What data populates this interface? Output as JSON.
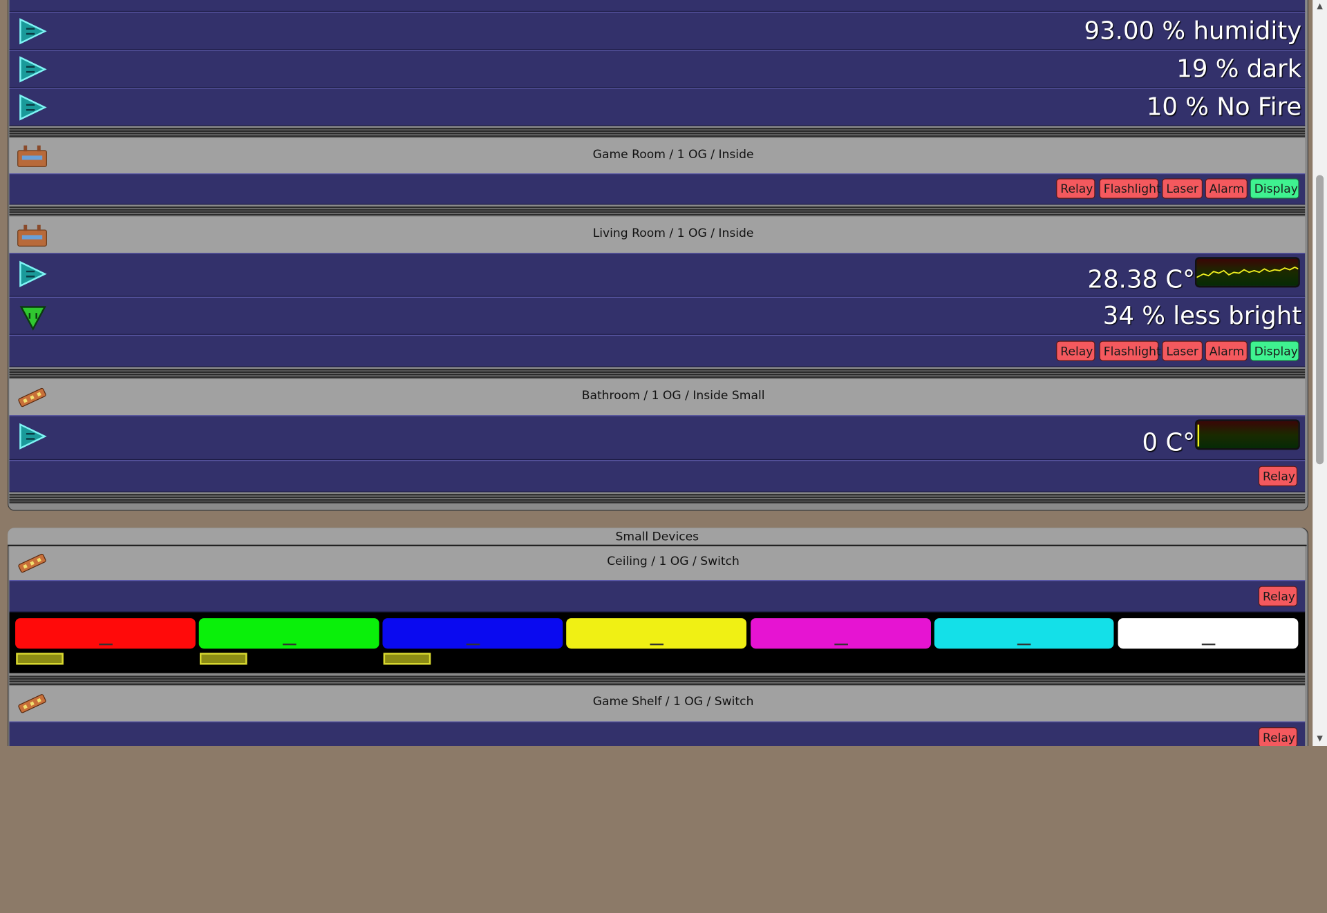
{
  "sensors_top": [
    {
      "value": "93.00 % humidity"
    },
    {
      "value": "19 % dark"
    },
    {
      "value": "10 % No Fire"
    }
  ],
  "game_room": {
    "title": "Game Room / 1 OG / Inside",
    "buttons": [
      "Relay",
      "Flashlight",
      "Laser",
      "Alarm",
      "Display"
    ]
  },
  "living_room": {
    "title": "Living Room / 1 OG / Inside",
    "temperature": "28.38 C°",
    "brightness": "34 % less bright",
    "buttons": [
      "Relay",
      "Flashlight",
      "Laser",
      "Alarm",
      "Display"
    ]
  },
  "bathroom": {
    "title": "Bathroom / 1 OG / Inside Small",
    "temperature": "0 C°",
    "buttons": [
      "Relay"
    ]
  },
  "small_devices": {
    "title": "Small Devices",
    "ceiling": {
      "title": "Ceiling / 1 OG / Switch",
      "buttons": [
        "Relay"
      ],
      "colors": [
        "#ff0a0a",
        "#0af00a",
        "#0a0af0",
        "#f0f014",
        "#e614d2",
        "#14e0e8",
        "#ffffff"
      ],
      "levels": [
        true,
        true,
        true,
        false,
        false,
        false,
        false
      ]
    },
    "game_shelf": {
      "title": "Game Shelf / 1 OG / Switch",
      "buttons": [
        "Relay"
      ]
    }
  },
  "colors": {
    "relay_off": "#f4595e",
    "display_on": "#3ff290",
    "row_bg": "#33316b",
    "header_bg": "#a1a1a1"
  }
}
